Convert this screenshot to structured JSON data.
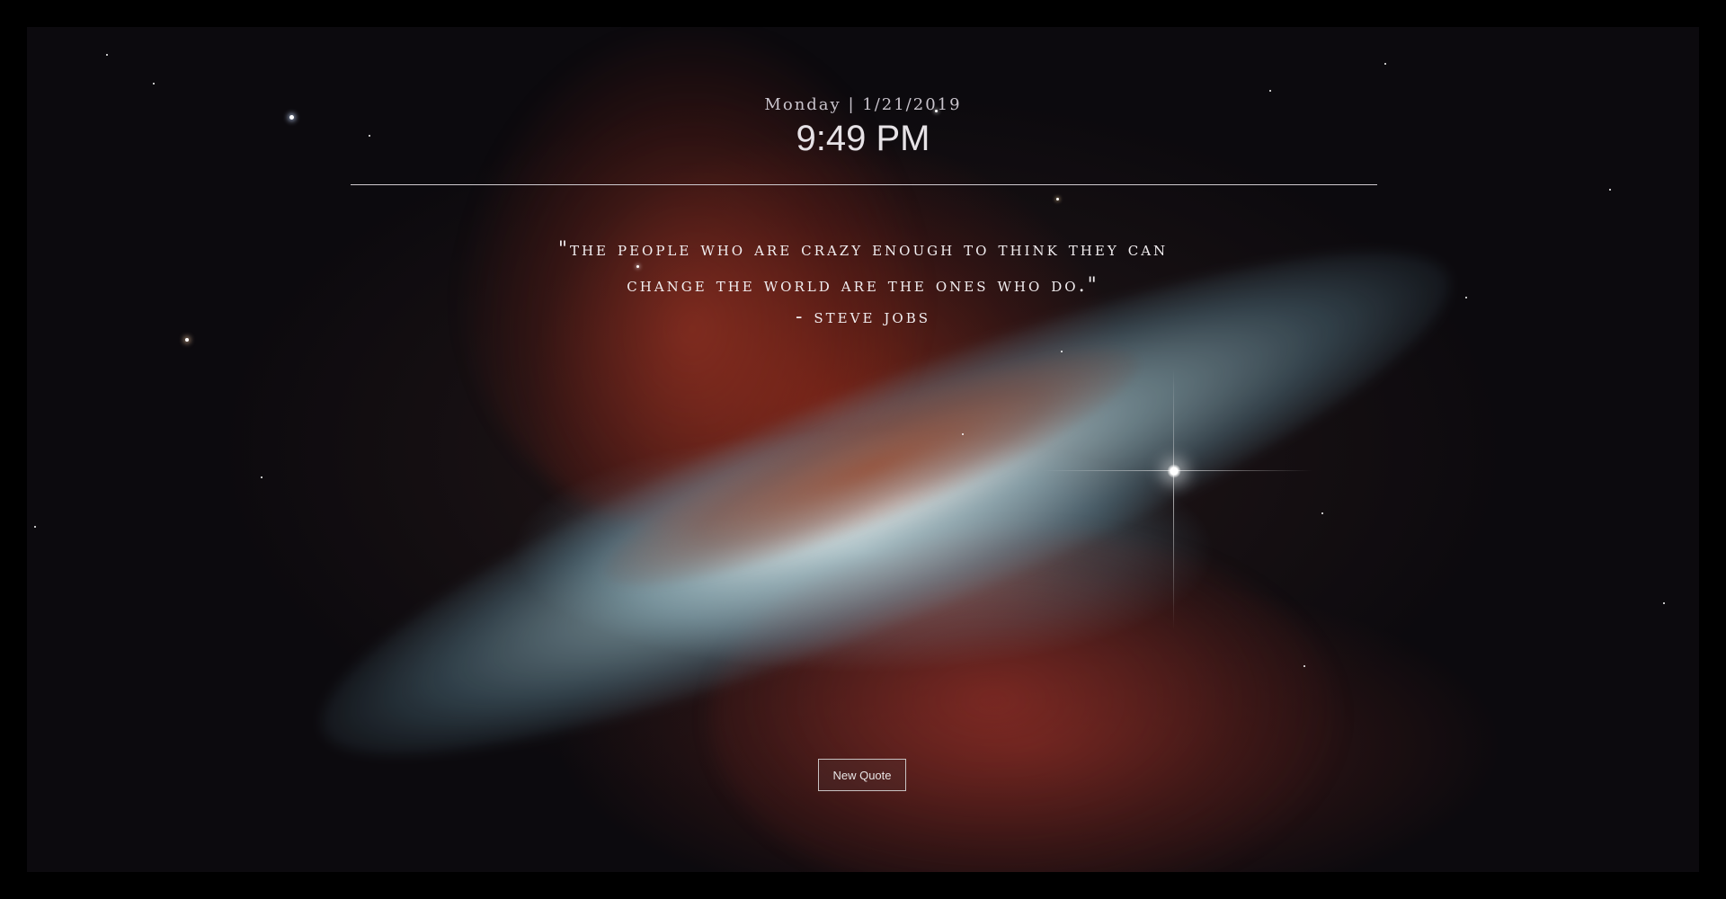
{
  "header": {
    "day": "Monday",
    "separator": "|",
    "date": "1/21/2019",
    "time": "9:49 PM"
  },
  "quote": {
    "line1": "\"The people who are crazy enough to think they can",
    "line2": "change the world are the ones who do.\"",
    "author": "- Steve Jobs"
  },
  "actions": {
    "new_quote_label": "New Quote"
  },
  "colors": {
    "frame": "#000000",
    "text": "#f2eef0",
    "divider": "#cfcacf"
  }
}
